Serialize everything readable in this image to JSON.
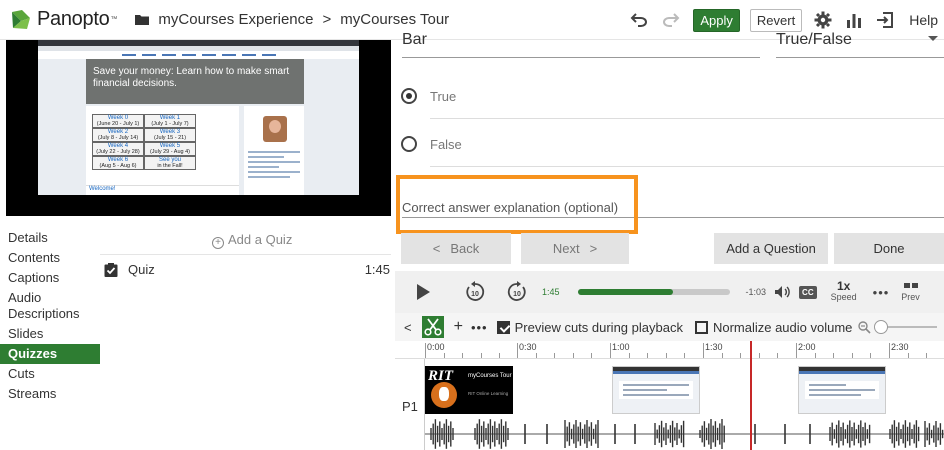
{
  "app": {
    "logo_text": "Panopto",
    "logo_tm": "™"
  },
  "breadcrumb": {
    "folder": "myCourses Experience",
    "separator": ">",
    "session": "myCourses Tour"
  },
  "toolbar": {
    "apply_label": "Apply",
    "revert_label": "Revert",
    "help_label": "Help",
    "brand_green": "#2e7d32"
  },
  "video": {
    "hero_text": "Save your money: Learn how to make smart financial decisions.",
    "weeks": [
      {
        "title": "Week 0",
        "dates": "(June 20 - July 1)"
      },
      {
        "title": "Week 1",
        "dates": "(July 1 - July 7)"
      },
      {
        "title": "Week 2",
        "dates": "(July 8 - July 14)"
      },
      {
        "title": "Week 3",
        "dates": "(July 15 - 21)"
      },
      {
        "title": "Week 4",
        "dates": "(July 22 - July 28)"
      },
      {
        "title": "Week 5",
        "dates": "(July 29 - Aug 4)"
      },
      {
        "title": "Week 6",
        "dates": "(Aug 5 - Aug 6)"
      },
      {
        "title": "See you",
        "dates": "in the Fall!"
      }
    ],
    "welcome": "Welcome!"
  },
  "sidebar": {
    "items": [
      {
        "label": "Details",
        "active": false
      },
      {
        "label": "Contents",
        "active": false
      },
      {
        "label": "Captions",
        "active": false
      },
      {
        "label": "Audio Descriptions",
        "active": false
      },
      {
        "label": "Slides",
        "active": false
      },
      {
        "label": "Quizzes",
        "active": true
      },
      {
        "label": "Cuts",
        "active": false
      },
      {
        "label": "Streams",
        "active": false
      }
    ]
  },
  "quiz_list": {
    "add_label": "Add a Quiz",
    "items": [
      {
        "title": "Quiz",
        "time": "1:45"
      }
    ]
  },
  "editor": {
    "question_text": "Bar",
    "question_type": "True/False",
    "options": [
      {
        "label": "True",
        "selected": true
      },
      {
        "label": "False",
        "selected": false
      }
    ],
    "explanation_placeholder": "Correct answer explanation (optional)",
    "highlight_color": "#f7931e",
    "back_label": "Back",
    "next_label": "Next",
    "add_question_label": "Add a Question",
    "done_label": "Done"
  },
  "player": {
    "current_time": "1:45",
    "remaining_time": "-1:03",
    "progress": 0.625,
    "cc_label": "CC",
    "speed_value": "1x",
    "speed_label": "Speed",
    "more_label": "•••",
    "preview_label": "Prev"
  },
  "edit_toolbar": {
    "more_label": "•••",
    "preview_cuts_label": "Preview cuts during playback",
    "preview_cuts_checked": true,
    "normalize_label": "Normalize audio volume",
    "normalize_checked": false
  },
  "timeline": {
    "ticks": [
      "0:00",
      "0:30",
      "1:00",
      "1:30",
      "2:00",
      "2:30"
    ],
    "track_label": "P1",
    "rit_title": "myCourses Tour",
    "rit_sub": "RIT Online Learning",
    "rit_logo": "RIT"
  }
}
